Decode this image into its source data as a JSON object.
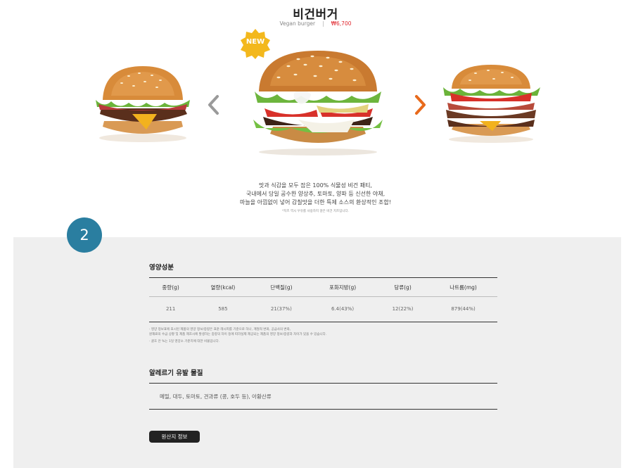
{
  "product": {
    "name": "비건버거",
    "name_en": "Vegan burger",
    "separator": "|",
    "price": "₩6,700",
    "badge": "NEW"
  },
  "carousel": {
    "prev_icon": "chevron-left-icon",
    "next_icon": "chevron-right-icon",
    "arrow_colors": {
      "prev": "#9a9a9a",
      "next": "#e86a1c"
    }
  },
  "description": {
    "lines": [
      "맛과 식감을 모두 잡은 100% 식물성 비건 패티,",
      "국내에서 당일 공수한 양상추, 토마토, 양파 등 신선한 야채,",
      "마늘을 아낌없이 넣어 감칠맛을 더한 특제 소스의 환상적인 조합!"
    ],
    "note": "*치즈 역시 우유를 사용하지 않은 비건 치즈입니다."
  },
  "step_badge": "2",
  "nutrition": {
    "title": "영양성분",
    "headers": [
      "중량(g)",
      "열량(kcal)",
      "단백질(g)",
      "포화지방(g)",
      "당류(g)",
      "나트륨(mg)"
    ],
    "values": [
      "211",
      "585",
      "21(37%)",
      "6.4(43%)",
      "12(22%)",
      "879(44%)"
    ],
    "notes": [
      "· 영양 정보표에 표시된 제품의 영양 정보/중량은 표준 레시피를 기준으로 하나, 계절적 변화, 공급사의 변화,",
      "  원재료의 수급 상황 및 제품 제조시에 발생하는 중량의 차이 등에 따라실제 제공되는 제품의 영양 정보/중량과 차이가 있을 수 있습니다.",
      "· 괄호 안 %는 1일 영양소 기준치에 대한 비율입니다."
    ]
  },
  "allergen": {
    "title": "알레르기 유발 물질",
    "text": "메밀, 대두, 토마토, 견과류 (콩, 호두 등), 아황산류"
  },
  "origin_button": "원산지 정보",
  "colors": {
    "accent_price": "#e0262d",
    "badge_gold": "#f3b81d",
    "step_badge": "#2a7ea0",
    "panel_bg": "#efefef"
  }
}
